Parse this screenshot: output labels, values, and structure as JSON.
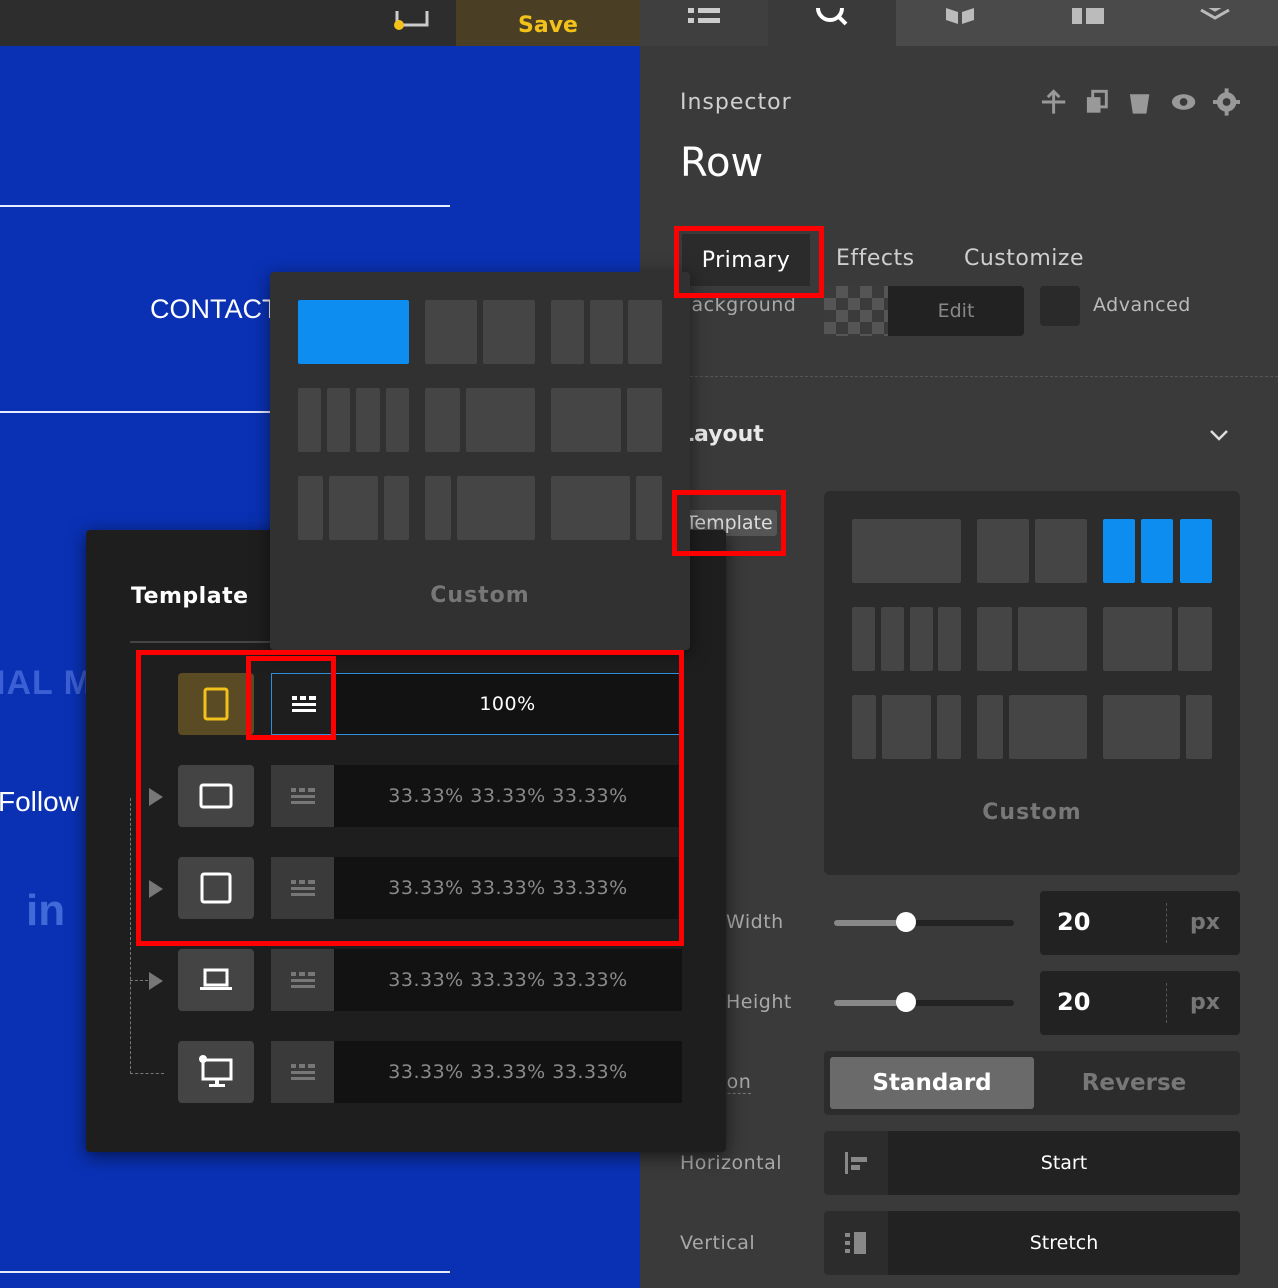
{
  "toolbar": {
    "save_label": "Save"
  },
  "canvas": {
    "contact_text": "CONTACT",
    "partial_heading": "IAL M",
    "follow_text": "Follow U",
    "linkedin_text": "in"
  },
  "inspector": {
    "title": "Inspector",
    "element_name": "Row",
    "tabs": {
      "primary": "Primary",
      "effects": "Effects",
      "customize": "Customize"
    },
    "background": {
      "label": "Background",
      "edit": "Edit",
      "advanced": "Advanced"
    },
    "layout": {
      "heading": "Layout",
      "template_label": "Template",
      "custom_label": "Custom"
    },
    "width": {
      "label": "Width",
      "value": "20",
      "unit": "px",
      "slider_fraction": 0.4
    },
    "height": {
      "label": "Height",
      "value": "20",
      "unit": "px",
      "slider_fraction": 0.4
    },
    "direction": {
      "label": "Direction",
      "standard": "Standard",
      "reverse": "Reverse"
    },
    "horizontal": {
      "label": "Horizontal",
      "value": "Start"
    },
    "vertical": {
      "label": "Vertical",
      "value": "Stretch"
    }
  },
  "template_popup": {
    "custom_label": "Custom"
  },
  "responsive_popup": {
    "title": "Template",
    "rows": [
      {
        "device": "tablet-portrait",
        "value": "100%"
      },
      {
        "device": "tablet-landscape",
        "value": "33.33% 33.33% 33.33%"
      },
      {
        "device": "square",
        "value": "33.33% 33.33% 33.33%"
      },
      {
        "device": "laptop",
        "value": "33.33% 33.33% 33.33%"
      },
      {
        "device": "desktop",
        "value": "33.33% 33.33% 33.33%"
      }
    ]
  },
  "colors": {
    "accent_blue": "#0d8df0",
    "save_yellow": "#f2c21b",
    "canvas_blue": "#0a31b4",
    "highlight_red": "#ff0000"
  }
}
